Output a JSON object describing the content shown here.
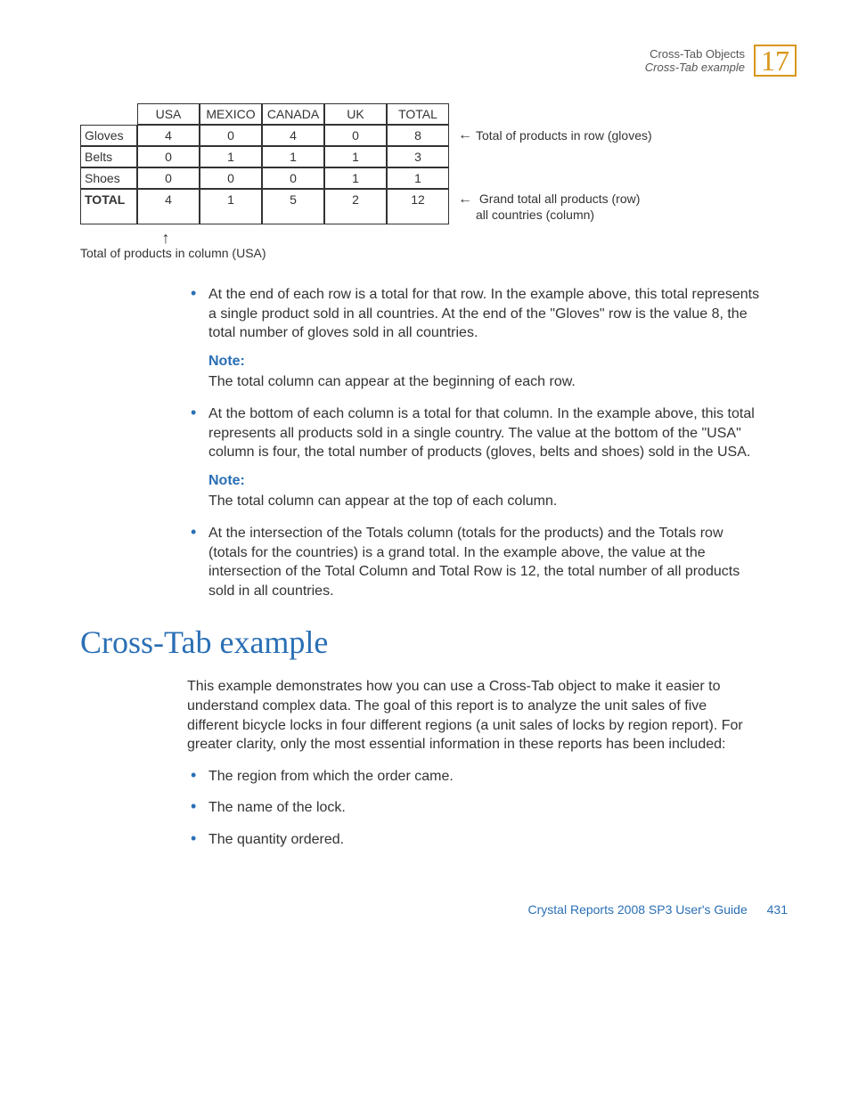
{
  "header": {
    "top": "Cross-Tab Objects",
    "sub": "Cross-Tab example",
    "chapter": "17"
  },
  "chart_data": {
    "type": "table",
    "columns": [
      "USA",
      "MEXICO",
      "CANADA",
      "UK",
      "TOTAL"
    ],
    "rows": [
      {
        "label": "Gloves",
        "values": [
          4,
          0,
          4,
          0,
          8
        ]
      },
      {
        "label": "Belts",
        "values": [
          0,
          1,
          1,
          1,
          3
        ]
      },
      {
        "label": "Shoes",
        "values": [
          0,
          0,
          0,
          1,
          1
        ]
      },
      {
        "label": "TOTAL",
        "values": [
          4,
          1,
          5,
          2,
          12
        ]
      }
    ],
    "row_annotation": "Total of products in row (gloves)",
    "grand_annotation_line1": "Grand total all products (row)",
    "grand_annotation_line2": "all countries (column)",
    "column_caption": "Total of products in column (USA)"
  },
  "bullets": {
    "b1": "At the end of each row is a total for that row. In the example above, this total represents a single product sold in all countries. At the end of the \"Gloves\" row is the value 8, the total number of gloves sold in all countries.",
    "note_label": "Note:",
    "note1": "The total column can appear at the beginning of each row.",
    "b2": "At the bottom of each column is a total for that column. In the example above, this total represents all products sold in a single country. The value at the bottom of the \"USA\" column is four, the total number of products (gloves, belts and shoes) sold in the USA.",
    "note2": "The total column can appear at the top of each column.",
    "b3": "At the intersection of the Totals column (totals for the products) and the Totals row (totals for the countries) is a grand total. In the example above, the value at the intersection of the Total Column and Total Row is 12, the total number of all products sold in all countries."
  },
  "section": {
    "heading": "Cross-Tab example",
    "intro": "This example demonstrates how you can use a Cross-Tab object to make it easier to understand complex data. The goal of this report is to analyze the unit sales of five different bicycle locks in four different regions (a unit sales of locks by region report). For greater clarity, only the most essential information in these reports has been included:",
    "items": [
      "The region from which the order came.",
      "The name of the lock.",
      "The quantity ordered."
    ]
  },
  "footer": {
    "text": "Crystal Reports 2008 SP3 User's Guide",
    "page": "431"
  }
}
